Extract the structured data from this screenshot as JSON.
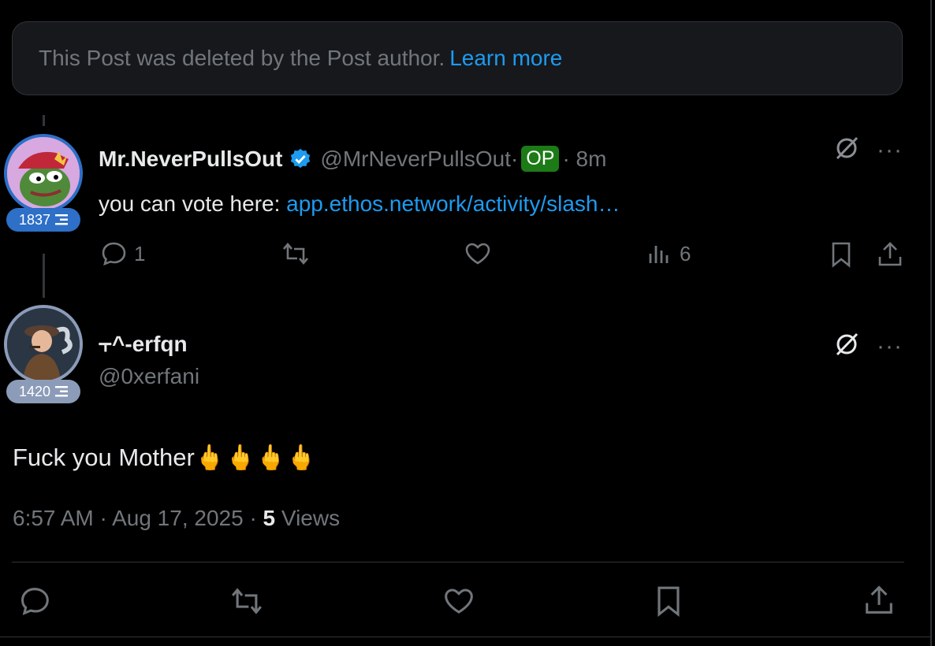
{
  "deleted_notice": {
    "text": "This Post was deleted by the Post author.",
    "link": "Learn more"
  },
  "reply1": {
    "display_name": "Mr.NeverPullsOut",
    "handle": "@MrNeverPullsOut",
    "op_badge": "OP",
    "time": "· 8m",
    "text_prefix": "you can vote here: ",
    "link_text": "app.ethos.network/activity/slash…",
    "score": "1837",
    "replies": "1",
    "views": "6",
    "badge_color": "#2e6fc7"
  },
  "reply2": {
    "display_name": "⫟^-erfqn",
    "handle": "@0xerfani",
    "score": "1420",
    "text": "Fuck you Mother🖕🖕🖕🖕",
    "badge_color": "#8b9bb8"
  },
  "meta": {
    "time": "6:57 AM · Aug 17, 2025 · ",
    "views_count": "5",
    "views_label": " Views"
  },
  "icons": [
    "reply-icon",
    "repost-icon",
    "like-icon",
    "views-icon",
    "bookmark-icon",
    "share-icon",
    "grok-icon",
    "more-icon",
    "verified-icon"
  ],
  "colors": {
    "accent": "#1d9bf0",
    "muted": "#71767b",
    "op_green": "#1c7b16"
  }
}
